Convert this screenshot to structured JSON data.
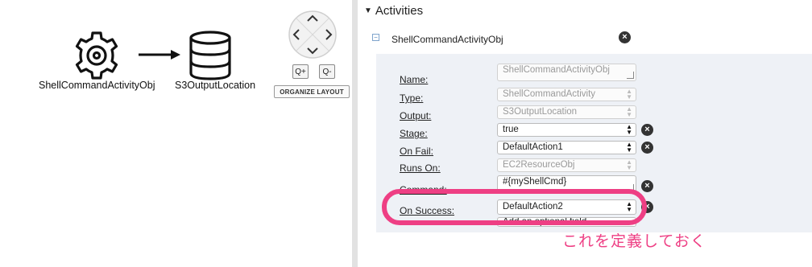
{
  "canvas": {
    "nodes": [
      {
        "label": "ShellCommandActivityObj",
        "icon": "gear-icon"
      },
      {
        "label": "S3OutputLocation",
        "icon": "database-icon"
      }
    ],
    "zoom_in_label": "Q+",
    "zoom_out_label": "Q-",
    "organize_label": "ORGANIZE LAYOUT"
  },
  "panel": {
    "section_title": "Activities",
    "activity_name": "ShellCommandActivityObj",
    "remove_symbol": "×",
    "fields": {
      "name": {
        "label": "Name:",
        "value": "ShellCommandActivityObj"
      },
      "type": {
        "label": "Type:",
        "value": "ShellCommandActivity"
      },
      "output": {
        "label": "Output:",
        "value": "S3OutputLocation"
      },
      "stage": {
        "label": "Stage:",
        "value": "true"
      },
      "on_fail": {
        "label": "On Fail:",
        "value": "DefaultAction1"
      },
      "runs_on": {
        "label": "Runs On:",
        "value": "EC2ResourceObj"
      },
      "command": {
        "label": "Command:",
        "value": "#{myShellCmd}"
      },
      "on_success": {
        "label": "On Success:",
        "value": "DefaultAction2"
      },
      "add_optional": {
        "value": "Add an optional field..."
      }
    }
  },
  "annotation": {
    "text": "これを定義しておく",
    "color": "#ee3f84"
  }
}
